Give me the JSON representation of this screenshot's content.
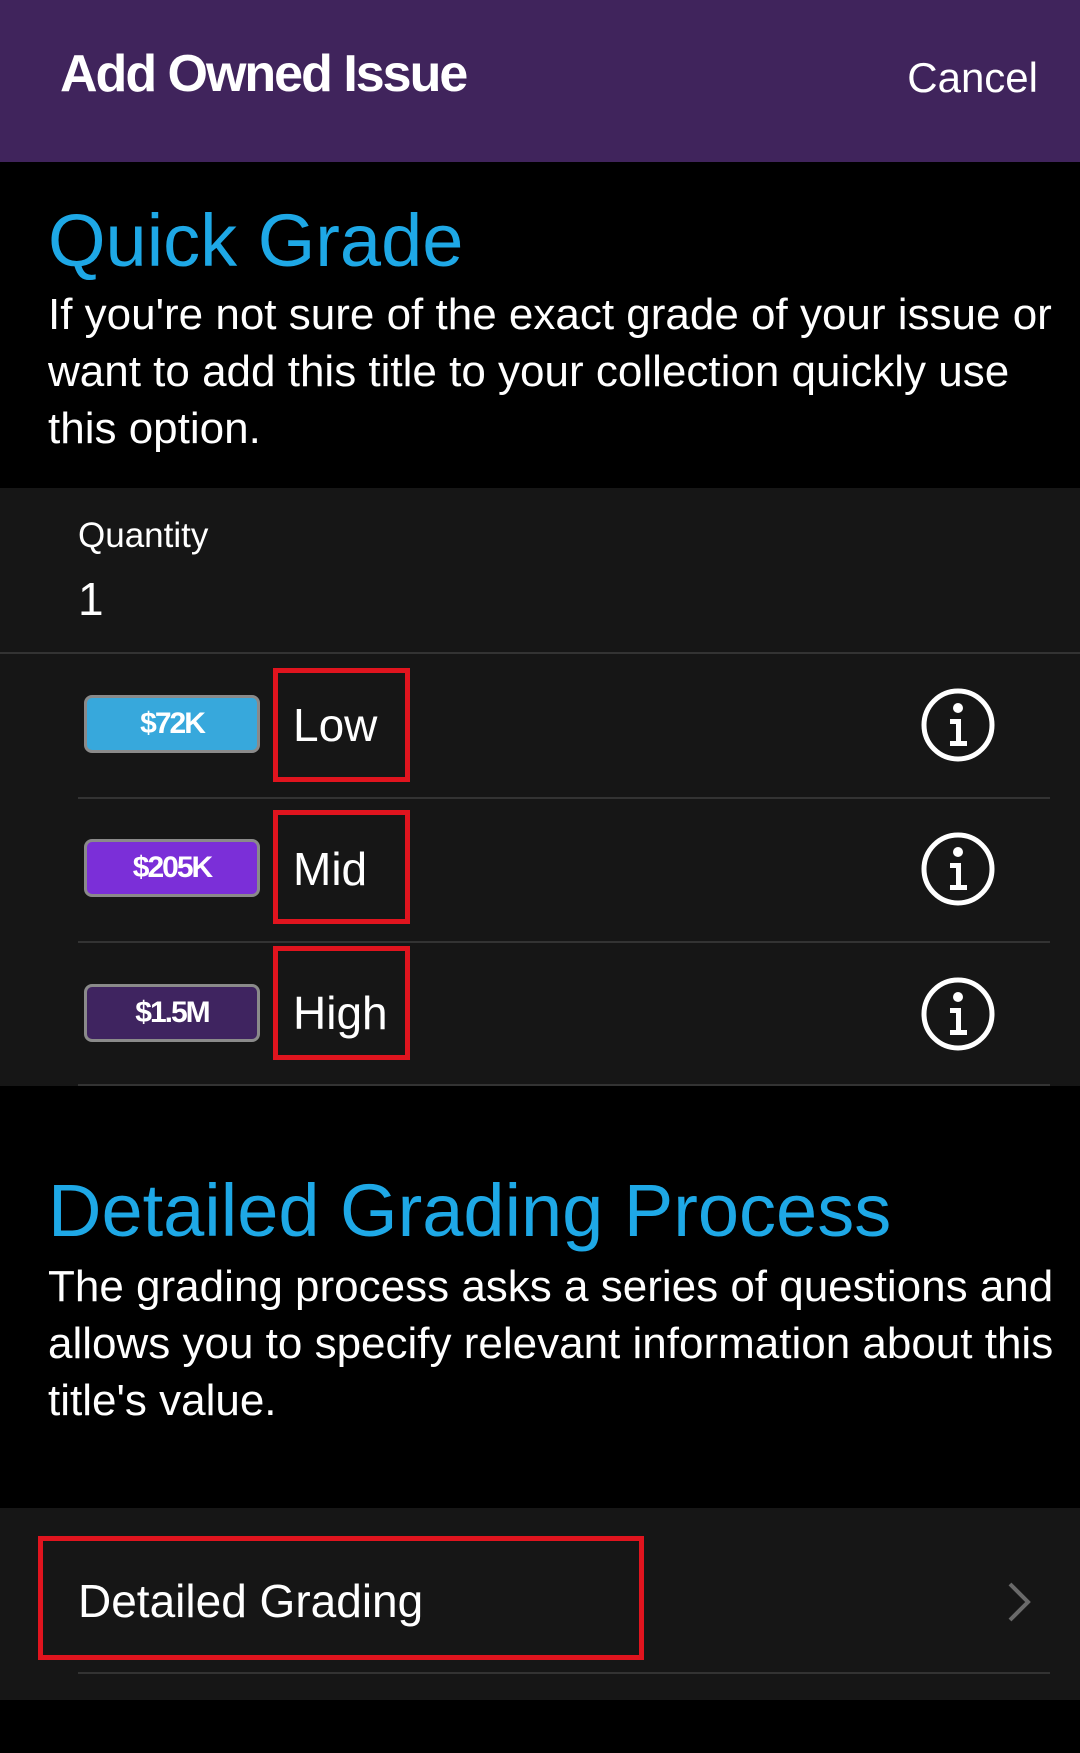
{
  "header": {
    "title": "Add Owned Issue",
    "cancel_label": "Cancel",
    "background_color": "#40245c"
  },
  "quick_grade": {
    "title": "Quick Grade",
    "description": "If you're not sure of the exact grade of your issue or want to add this title to your collection quickly use this option.",
    "quantity_label": "Quantity",
    "quantity_value": "1",
    "grades": [
      {
        "value": "$72K",
        "label": "Low",
        "badge_color": "#37a8dc",
        "icon": "info-icon"
      },
      {
        "value": "$205K",
        "label": "Mid",
        "badge_color": "#7b2fd8",
        "icon": "info-icon"
      },
      {
        "value": "$1.5M",
        "label": "High",
        "badge_color": "#3f2460",
        "icon": "info-icon"
      }
    ]
  },
  "detailed": {
    "title": "Detailed Grading Process",
    "description": "The grading process asks a series of questions and allows you to specify relevant information about this title's value.",
    "item_label": "Detailed Grading",
    "icon": "chevron-right-icon"
  },
  "colors": {
    "accent": "#1ea8e6",
    "highlight": "#e0141e"
  }
}
